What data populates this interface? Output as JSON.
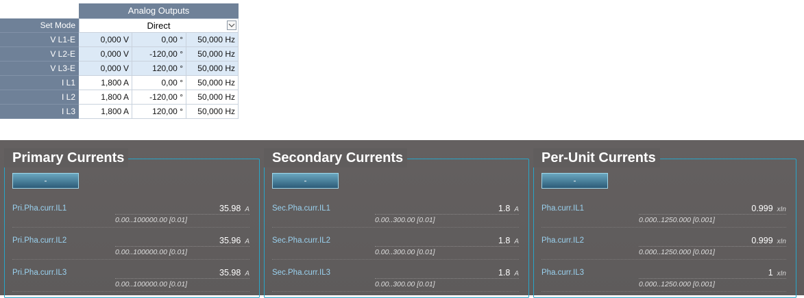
{
  "analog_outputs": {
    "title": "Analog Outputs",
    "set_mode_label": "Set Mode",
    "set_mode_value": "Direct",
    "rows": [
      {
        "label": "V L1-E",
        "magnitude": "0,000 V",
        "angle": "0,00 °",
        "frequency": "50,000 Hz",
        "style": "blue"
      },
      {
        "label": "V L2-E",
        "magnitude": "0,000 V",
        "angle": "-120,00 °",
        "frequency": "50,000 Hz",
        "style": "blue"
      },
      {
        "label": "V L3-E",
        "magnitude": "0,000 V",
        "angle": "120,00 °",
        "frequency": "50,000 Hz",
        "style": "blue"
      },
      {
        "label": "I L1",
        "magnitude": "1,800 A",
        "angle": "0,00 °",
        "frequency": "50,000 Hz",
        "style": "white"
      },
      {
        "label": "I L2",
        "magnitude": "1,800 A",
        "angle": "-120,00 °",
        "frequency": "50,000 Hz",
        "style": "white"
      },
      {
        "label": "I L3",
        "magnitude": "1,800 A",
        "angle": "120,00 °",
        "frequency": "50,000 Hz",
        "style": "white"
      }
    ]
  },
  "panels": [
    {
      "title": "Primary Currents",
      "button_label": "-",
      "items": [
        {
          "name": "Pri.Pha.curr.IL1",
          "value": "35.98",
          "unit": "A",
          "range": "0.00..100000.00 [0.01]"
        },
        {
          "name": "Pri.Pha.curr.IL2",
          "value": "35.96",
          "unit": "A",
          "range": "0.00..100000.00 [0.01]"
        },
        {
          "name": "Pri.Pha.curr.IL3",
          "value": "35.98",
          "unit": "A",
          "range": "0.00..100000.00 [0.01]"
        }
      ]
    },
    {
      "title": "Secondary Currents",
      "button_label": "-",
      "items": [
        {
          "name": "Sec.Pha.curr.IL1",
          "value": "1.8",
          "unit": "A",
          "range": "0.00..300.00 [0.01]"
        },
        {
          "name": "Sec.Pha.curr.IL2",
          "value": "1.8",
          "unit": "A",
          "range": "0.00..300.00 [0.01]"
        },
        {
          "name": "Sec.Pha.curr.IL3",
          "value": "1.8",
          "unit": "A",
          "range": "0.00..300.00 [0.01]"
        }
      ]
    },
    {
      "title": "Per-Unit Currents",
      "button_label": "-",
      "items": [
        {
          "name": "Pha.curr.IL1",
          "value": "0.999",
          "unit": "xIn",
          "range": "0.000..1250.000 [0.001]"
        },
        {
          "name": "Pha.curr.IL2",
          "value": "0.999",
          "unit": "xIn",
          "range": "0.000..1250.000 [0.001]"
        },
        {
          "name": "Pha.curr.IL3",
          "value": "1",
          "unit": "xIn",
          "range": "0.000..1250.000 [0.001]"
        }
      ]
    }
  ]
}
